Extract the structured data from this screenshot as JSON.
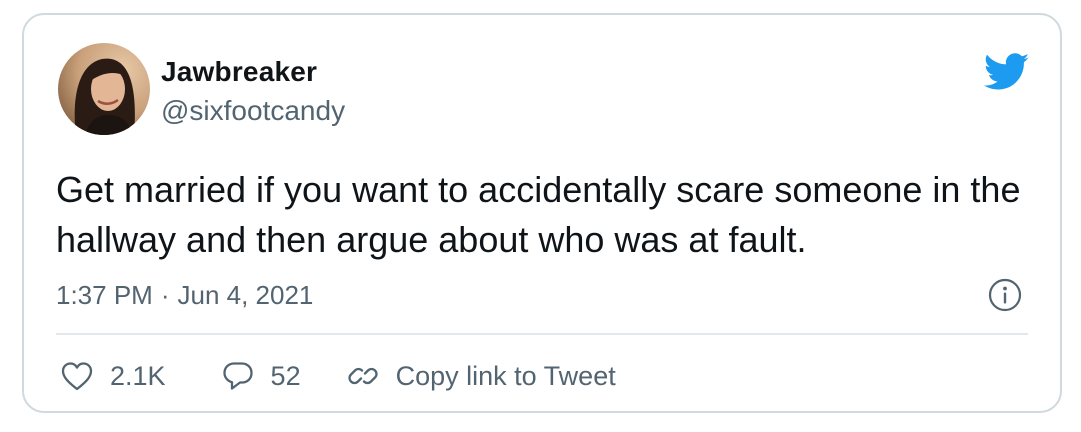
{
  "author": {
    "name": "Jawbreaker",
    "handle": "@sixfootcandy"
  },
  "tweet": {
    "text": "Get married if you want to accidentally scare someone in the hallway and then argue about who was at fault.",
    "time": "1:37 PM",
    "separator": "·",
    "date": "Jun 4, 2021"
  },
  "actions": {
    "likes": "2.1K",
    "replies": "52",
    "copy_link": "Copy link to Tweet"
  },
  "icons": {
    "brand": "twitter-bird-icon",
    "info": "info-icon",
    "like": "heart-icon",
    "reply": "speech-bubble-icon",
    "copy": "link-icon"
  },
  "colors": {
    "brand": "#1d9bf0",
    "text": "#0f1419",
    "secondary": "#536471",
    "border": "#cfd9de"
  }
}
